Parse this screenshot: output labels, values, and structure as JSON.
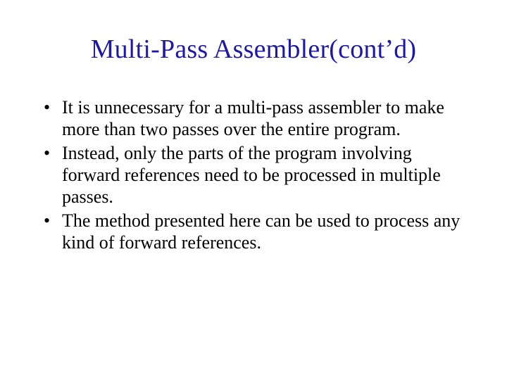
{
  "slide": {
    "title": "Multi-Pass Assembler(cont’d)",
    "bullets": [
      "It is unnecessary for a multi-pass assembler to make more than two passes over the entire program.",
      "Instead, only the parts of the program involving forward references need to be processed in multiple passes.",
      "The method presented here can be used to process any kind of forward references."
    ]
  }
}
